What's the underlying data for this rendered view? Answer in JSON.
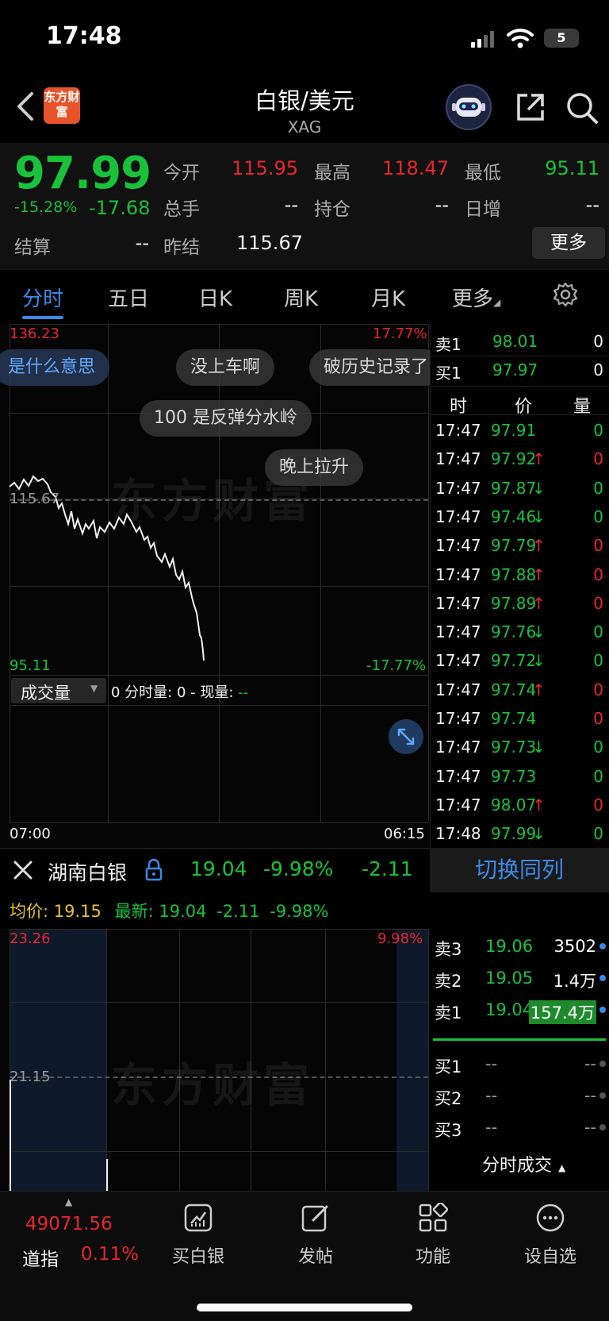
{
  "status": {
    "time": "17:48",
    "battery": "5"
  },
  "header": {
    "logo_text": "东方财富",
    "title": "白银/美元",
    "subtitle": "XAG"
  },
  "quote": {
    "price": "97.99",
    "change_pct": "-15.28%",
    "change": "-17.68",
    "open_label": "今开",
    "open": "115.95",
    "high_label": "最高",
    "high": "118.47",
    "low_label": "最低",
    "low": "95.11",
    "volume_label": "总手",
    "volume": "--",
    "oi_label": "持仓",
    "oi": "--",
    "daily_inc_label": "日增",
    "daily_inc": "--",
    "settle_label": "结算",
    "settle": "--",
    "prev_settle_label": "昨结",
    "prev_settle": "115.67",
    "more_label": "更多"
  },
  "tabs": [
    "分时",
    "五日",
    "日K",
    "周K",
    "月K",
    "更多"
  ],
  "chart": {
    "y_max": "136.23",
    "y_mid": "115.67",
    "y_min": "95.11",
    "pct_max": "17.77%",
    "pct_min": "-17.77%",
    "volume_label": "成交量",
    "volume_info_prefix": "0 分时量: 0 - 现量: ",
    "volume_info_value": "--",
    "x_start": "07:00",
    "x_end": "06:15",
    "watermark": "东方财富",
    "comments": [
      "是什么意思",
      "没上车啊",
      "破历史记录了",
      "100 是反弹分水岭",
      "晚上拉升"
    ]
  },
  "orderbook_top": {
    "ask1_label": "卖1",
    "ask1_price": "98.01",
    "ask1_vol": "0",
    "bid1_label": "买1",
    "bid1_price": "97.97",
    "bid1_vol": "0",
    "headers": [
      "时",
      "价",
      "量"
    ]
  },
  "ticks": [
    {
      "time": "17:47",
      "price": "97.91",
      "arrow": "",
      "vol": "0",
      "color": "green"
    },
    {
      "time": "17:47",
      "price": "97.92",
      "arrow": "↑",
      "vol": "0",
      "color": "red"
    },
    {
      "time": "17:47",
      "price": "97.87",
      "arrow": "↓",
      "vol": "0",
      "color": "green"
    },
    {
      "time": "17:47",
      "price": "97.46",
      "arrow": "↓",
      "vol": "0",
      "color": "green"
    },
    {
      "time": "17:47",
      "price": "97.79",
      "arrow": "↑",
      "vol": "0",
      "color": "red"
    },
    {
      "time": "17:47",
      "price": "97.88",
      "arrow": "↑",
      "vol": "0",
      "color": "red"
    },
    {
      "time": "17:47",
      "price": "97.89",
      "arrow": "↑",
      "vol": "0",
      "color": "red"
    },
    {
      "time": "17:47",
      "price": "97.76",
      "arrow": "↓",
      "vol": "0",
      "color": "green"
    },
    {
      "time": "17:47",
      "price": "97.72",
      "arrow": "↓",
      "vol": "0",
      "color": "green"
    },
    {
      "time": "17:47",
      "price": "97.74",
      "arrow": "↑",
      "vol": "0",
      "color": "red"
    },
    {
      "time": "17:47",
      "price": "97.74",
      "arrow": "",
      "vol": "0",
      "color": "red"
    },
    {
      "time": "17:47",
      "price": "97.73",
      "arrow": "↓",
      "vol": "0",
      "color": "green"
    },
    {
      "time": "17:47",
      "price": "97.73",
      "arrow": "",
      "vol": "0",
      "color": "green"
    },
    {
      "time": "17:47",
      "price": "98.07",
      "arrow": "↑",
      "vol": "0",
      "color": "red"
    },
    {
      "time": "17:48",
      "price": "97.99",
      "arrow": "↓",
      "vol": "0",
      "color": "green"
    }
  ],
  "stock": {
    "name": "湖南白银",
    "price": "19.04",
    "pct": "-9.98%",
    "change": "-2.11",
    "switch_label": "切换同列",
    "avg_label": "均价:",
    "avg": "19.15",
    "latest_label": "最新:",
    "latest": "19.04",
    "latest_change": "-2.11",
    "latest_pct": "-9.98%",
    "y_max": "23.26",
    "y_mid": "21.15",
    "pct_max": "9.98%"
  },
  "book": [
    {
      "label": "卖3",
      "price": "19.06",
      "vol": "3502"
    },
    {
      "label": "卖2",
      "price": "19.05",
      "vol": "1.4万"
    },
    {
      "label": "卖1",
      "price": "19.04",
      "vol": "157.4万"
    },
    {
      "label": "买1",
      "price": "--",
      "vol": "--"
    },
    {
      "label": "买2",
      "price": "--",
      "vol": "--"
    },
    {
      "label": "买3",
      "price": "--",
      "vol": "--"
    }
  ],
  "book_footer": "分时成交",
  "nav": {
    "index_value": "49071.56",
    "index_name": "道指",
    "index_pct": "0.11%",
    "buy": "买白银",
    "post": "发帖",
    "func": "功能",
    "watch": "设自选"
  },
  "colors": {
    "up": "#e8262f",
    "down": "#19c23a",
    "accent": "#3b8ae6"
  }
}
